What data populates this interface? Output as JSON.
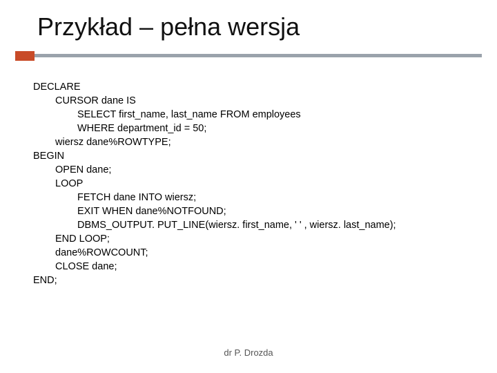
{
  "title": "Przykład – pełna wersja",
  "code": {
    "l0": "DECLARE",
    "l1": "CURSOR dane IS",
    "l2": "SELECT first_name, last_name FROM employees",
    "l3": "WHERE department_id = 50;",
    "l4": "wiersz dane%ROWTYPE;",
    "l5": "BEGIN",
    "l6": "OPEN dane;",
    "l7": "LOOP",
    "l8": "FETCH dane INTO wiersz;",
    "l9": "EXIT WHEN dane%NOTFOUND;",
    "l10": "DBMS_OUTPUT. PUT_LINE(wiersz. first_name, ' ' , wiersz. last_name);",
    "l11": "END LOOP;",
    "l12": "dane%ROWCOUNT;",
    "l13": "CLOSE dane;",
    "l14": "END;"
  },
  "footer": "dr P. Drozda"
}
